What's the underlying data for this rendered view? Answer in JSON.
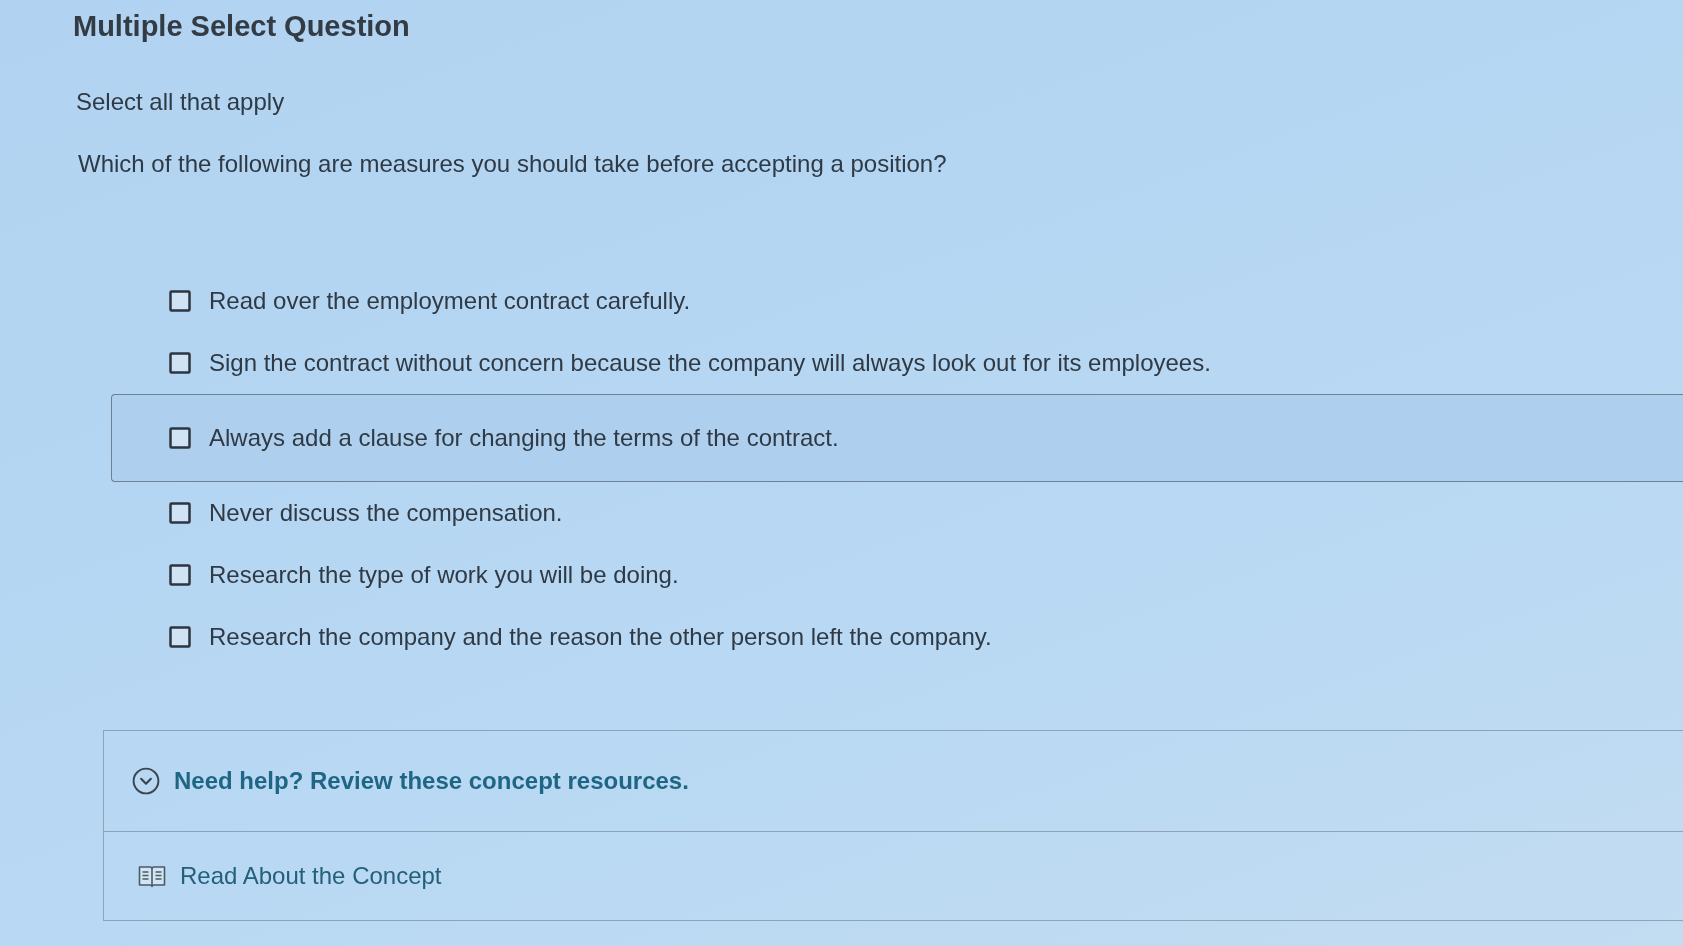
{
  "header": {
    "title": "Multiple Select Question",
    "instruction": "Select all that apply"
  },
  "question": "Which of the following are measures you should take before accepting a position?",
  "options": [
    {
      "label": "Read over the employment contract carefully.",
      "checked": false,
      "highlighted": false
    },
    {
      "label": "Sign the contract without concern because the company will always look out for its employees.",
      "checked": false,
      "highlighted": false
    },
    {
      "label": "Always add a clause for changing the terms of the contract.",
      "checked": false,
      "highlighted": true
    },
    {
      "label": "Never discuss the compensation.",
      "checked": false,
      "highlighted": false
    },
    {
      "label": "Research the type of work you will be doing.",
      "checked": false,
      "highlighted": false
    },
    {
      "label": "Research the company and the reason the other person left the company.",
      "checked": false,
      "highlighted": false
    }
  ],
  "help": {
    "title": "Need help? Review these concept resources.",
    "expanded": true,
    "resources": [
      {
        "label": "Read About the Concept"
      }
    ]
  }
}
